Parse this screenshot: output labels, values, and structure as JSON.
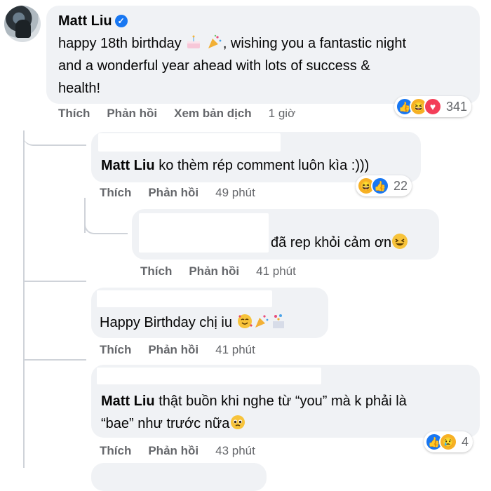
{
  "comments": [
    {
      "author": "Matt Liu",
      "text_part1": "happy 18th birthday ",
      "text_part2": ", wishing you a fantastic night",
      "text_line2": "and a wonderful year ahead with lots of success &",
      "text_line3": "health!",
      "actions": {
        "like": "Thích",
        "reply": "Phản hồi",
        "translate": "Xem bản dịch",
        "time": "1 giờ"
      },
      "reaction_count": "341",
      "reaction_icons": [
        "like-icon",
        "haha-icon",
        "love-icon"
      ]
    },
    {
      "author": "Matt Liu",
      "text": " ko thèm rép comment luôn kìa :)))",
      "actions": {
        "like": "Thích",
        "reply": "Phản hồi",
        "time": "49 phút"
      },
      "reaction_count": "22",
      "reaction_icons": [
        "haha-icon",
        "like-icon"
      ]
    },
    {
      "text": "đã rep khỏi cảm ơn",
      "actions": {
        "like": "Thích",
        "reply": "Phản hồi",
        "time": "41 phút"
      }
    },
    {
      "text": "Happy Birthday chị iu ",
      "actions": {
        "like": "Thích",
        "reply": "Phản hồi",
        "time": "41 phút"
      }
    },
    {
      "author": "Matt Liu",
      "text_line1": " thật buồn khi nghe từ “you” mà k phải là",
      "text_line2": "“bae” như trước nữa",
      "actions": {
        "like": "Thích",
        "reply": "Phản hồi",
        "time": "43 phút"
      },
      "reaction_count": "4",
      "reaction_icons": [
        "like-icon",
        "sad-icon"
      ]
    }
  ],
  "colors": {
    "bubble": "#f0f2f5",
    "secondary_text": "#65676b",
    "accent": "#1877f2"
  }
}
